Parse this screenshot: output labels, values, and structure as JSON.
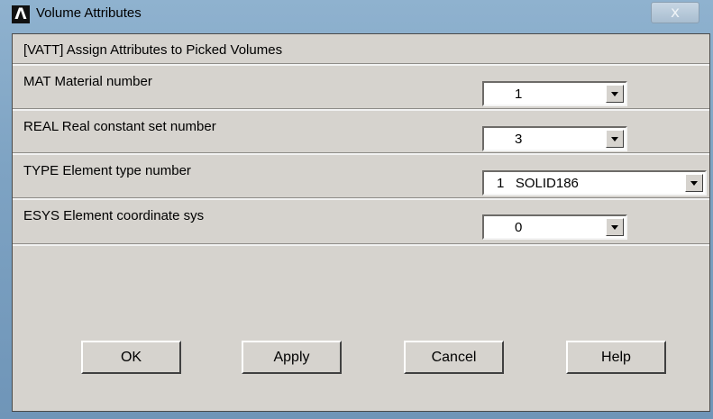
{
  "window": {
    "title": "Volume Attributes",
    "close_label": "x"
  },
  "header": {
    "text": "[VATT]  Assign Attributes to Picked Volumes"
  },
  "fields": [
    {
      "label": "MAT   Material number",
      "value": "1"
    },
    {
      "label": "REAL  Real constant set number",
      "value": "3"
    },
    {
      "label": "TYPE  Element type number",
      "value": "1   SOLID186"
    },
    {
      "label": "ESYS  Element coordinate sys",
      "value": "0"
    }
  ],
  "buttons": {
    "ok": "OK",
    "apply": "Apply",
    "cancel": "Cancel",
    "help": "Help"
  }
}
